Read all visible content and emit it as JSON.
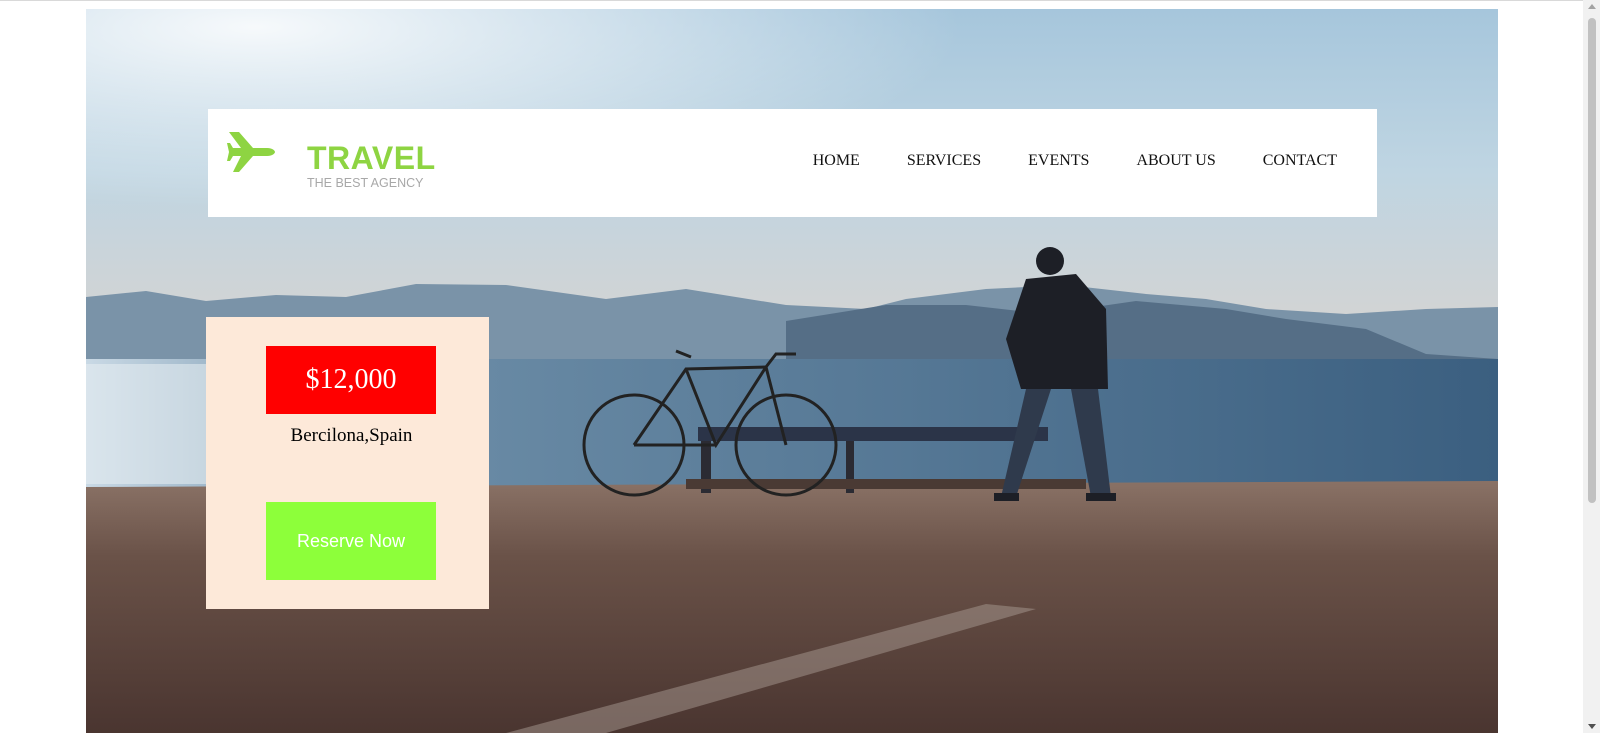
{
  "brand": {
    "name": "TRAVEL",
    "tagline": "THE BEST AGENCY",
    "accent_color": "#8ed442",
    "logo_icon": "airplane-icon"
  },
  "nav": {
    "items": [
      "HOME",
      "SERVICES",
      "EVENTS",
      "ABOUT US",
      "CONTACT"
    ]
  },
  "offer": {
    "price": "$12,000",
    "location": "Bercilona,Spain",
    "cta_label": "Reserve Now",
    "price_bg": "#ff0000",
    "cta_bg": "#8dff3a",
    "card_bg": "#fde9d9"
  }
}
